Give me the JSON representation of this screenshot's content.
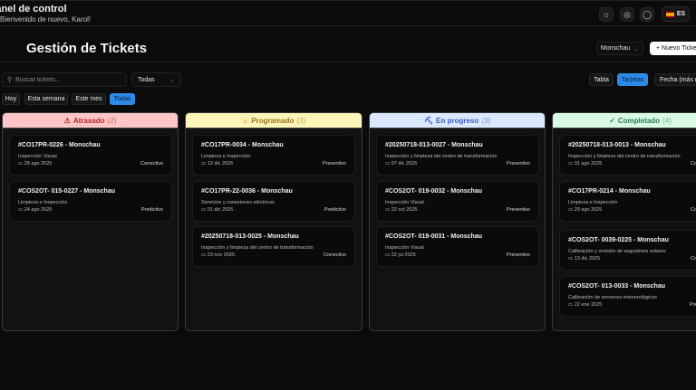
{
  "app": {
    "title": "Panel de control",
    "subtitle": "Bienvenido de nuevo, Karol!",
    "lang": "ES"
  },
  "icons": [
    "sun-icon",
    "palette-icon",
    "chat-icon"
  ],
  "page": {
    "title": "Gestión de Tickets",
    "site": "Monschau",
    "new_ticket": "+ Nuevo Ticket"
  },
  "filters": {
    "search_placeholder": "Buscar tickets...",
    "status": "Todas",
    "periods": [
      "Hoy",
      "Esta semana",
      "Este mes",
      "Todas"
    ],
    "active_period": "Todas",
    "views": [
      "Tabla",
      "Tarjetas"
    ],
    "active_view": "Tarjetas",
    "sort": "Fecha (más reciente)"
  },
  "columns": [
    {
      "title": "Atrasado",
      "count": "(2)",
      "icon": "⚠",
      "bg": "#fec6c6",
      "fg": "#b3262e",
      "cards": [
        {
          "title": "#CO17PR-0226 - Monschau",
          "desc": "Inspección Visual",
          "date": "28 ago 2025",
          "type": "Correctivo"
        },
        {
          "title": "#COS2OT- 015-0227 - Monschau",
          "desc": "Limpieza e Inspección",
          "date": "24 ago 2025",
          "type": "Predictivo"
        }
      ]
    },
    {
      "title": "Programado",
      "count": "(3)",
      "icon": "☼",
      "bg": "#fdf6b8",
      "fg": "#9a7420",
      "cards": [
        {
          "title": "#CO17PR-0034 - Monschau",
          "desc": "Limpieza e Inspección",
          "date": "13 dic 2025",
          "type": "Preventivo"
        },
        {
          "title": "#CO17PR-22-0036 - Monschau",
          "desc": "Servicios y conexiones eléctricas",
          "date": "01 dic 2025",
          "type": "Predictivo"
        },
        {
          "title": "#20250718-013-0025 - Monschau",
          "desc": "Inspección y limpieza del centro de transformación",
          "date": "23 nov 2025",
          "type": "Correctivo"
        }
      ]
    },
    {
      "title": "En progreso",
      "count": "(3)",
      "icon": "⛏",
      "bg": "#dbe8fe",
      "fg": "#3a5ec0",
      "cards": [
        {
          "title": "#20250718-013-0027 - Monschau",
          "desc": "Inspección y limpieza del centro de transformación",
          "date": "07 dic 2025",
          "type": "Preventivo"
        },
        {
          "title": "#COS2OT- 019-0032 - Monschau",
          "desc": "Inspección Visual",
          "date": "22 oct 2025",
          "type": "Preventivo"
        },
        {
          "title": "#COS2OT- 019-0031 - Monschau",
          "desc": "Inspección Visual",
          "date": "22 jul 2025",
          "type": "Preventivo"
        }
      ]
    },
    {
      "title": "Completado",
      "count": "(4)",
      "icon": "✓",
      "bg": "#d9fbe6",
      "fg": "#2a7a4c",
      "cards": [
        {
          "title": "#20250718-013-0013 - Monschau",
          "desc": "Inspección y limpieza del centro de transformación",
          "date": "31 ago 2025",
          "type": "Correctivo"
        },
        {
          "title": "#CO17PR-0214 - Monschau",
          "desc": "Limpieza e Inspección",
          "date": "29 ago 2025",
          "type": "Correctivo"
        },
        {
          "title": "#COS2OT- 0039-0225 - Monschau",
          "desc": "Calibración y revisión de seguidores solares",
          "date": "13 dic 2025",
          "type": "Correctivo"
        },
        {
          "title": "#COS2OT- 013-0033 - Monschau",
          "desc": "Calibración de sensores meteorológicos",
          "date": "22 ene 2025",
          "type": "Preventivo"
        }
      ]
    }
  ]
}
